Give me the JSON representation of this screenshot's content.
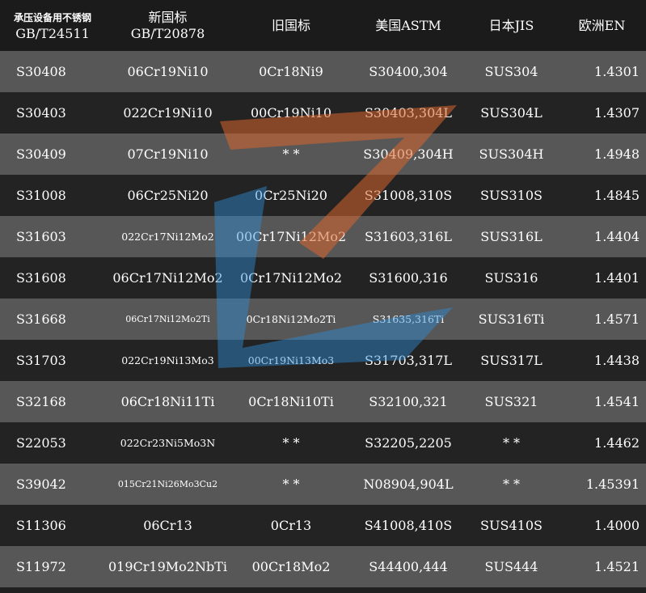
{
  "headers": {
    "col1_line1": "承压设备用不锈钢",
    "col1_line2": "GB/T24511",
    "col2_line1": "新国标",
    "col2_line2": "GB/T20878",
    "col3": "旧国标",
    "col4": "美国ASTM",
    "col5": "日本JIS",
    "col6": "欧洲EN"
  },
  "rows": [
    {
      "gb24511": "S30408",
      "gb20878": "06Cr19Ni10",
      "old_gb": "0Cr18Ni9",
      "astm": "S30400,304",
      "jis": "SUS304",
      "en": "1.4301"
    },
    {
      "gb24511": "S30403",
      "gb20878": "022Cr19Ni10",
      "old_gb": "00Cr19Ni10",
      "astm": "S30403,304L",
      "jis": "SUS304L",
      "en": "1.4307"
    },
    {
      "gb24511": "S30409",
      "gb20878": "07Cr19Ni10",
      "old_gb": "* *",
      "astm": "S30409,304H",
      "jis": "SUS304H",
      "en": "1.4948"
    },
    {
      "gb24511": "S31008",
      "gb20878": "06Cr25Ni20",
      "old_gb": "0Cr25Ni20",
      "astm": "S31008,310S",
      "jis": "SUS310S",
      "en": "1.4845"
    },
    {
      "gb24511": "S31603",
      "gb20878": "022Cr17Ni12Mo2",
      "old_gb": "00Cr17Ni12Mo2",
      "astm": "S31603,316L",
      "jis": "SUS316L",
      "en": "1.4404"
    },
    {
      "gb24511": "S31608",
      "gb20878": "06Cr17Ni12Mo2",
      "old_gb": "0Cr17Ni12Mo2",
      "astm": "S31600,316",
      "jis": "SUS316",
      "en": "1.4401"
    },
    {
      "gb24511": "S31668",
      "gb20878": "06Cr17Ni12Mo2Ti",
      "old_gb": "0Cr18Ni12Mo2Ti",
      "astm": "S31635,316Ti",
      "jis": "SUS316Ti",
      "en": "1.4571"
    },
    {
      "gb24511": "S31703",
      "gb20878": "022Cr19Ni13Mo3",
      "old_gb": "00Cr19Ni13Mo3",
      "astm": "S31703,317L",
      "jis": "SUS317L",
      "en": "1.4438"
    },
    {
      "gb24511": "S32168",
      "gb20878": "06Cr18Ni11Ti",
      "old_gb": "0Cr18Ni10Ti",
      "astm": "S32100,321",
      "jis": "SUS321",
      "en": "1.4541"
    },
    {
      "gb24511": "S22053",
      "gb20878": "022Cr23Ni5Mo3N",
      "old_gb": "* *",
      "astm": "S32205,2205",
      "jis": "* *",
      "en": "1.4462"
    },
    {
      "gb24511": "S39042",
      "gb20878": "015Cr21Ni26Mo3Cu2",
      "old_gb": "* *",
      "astm": "N08904,904L",
      "jis": "* *",
      "en": "1.45391"
    },
    {
      "gb24511": "S11306",
      "gb20878": "06Cr13",
      "old_gb": "0Cr13",
      "astm": "S41008,410S",
      "jis": "SUS410S",
      "en": "1.4000"
    },
    {
      "gb24511": "S11972",
      "gb20878": "019Cr19Mo2NbTi",
      "old_gb": "00Cr18Mo2",
      "astm": "S44400,444",
      "jis": "SUS444",
      "en": "1.4521"
    }
  ],
  "colors": {
    "header_bg": "#1b1b1b",
    "row_light": "#575757",
    "row_dark": "#232323",
    "text": "#ffffff",
    "watermark_orange": "#d9662e",
    "watermark_blue": "#2f8fd8"
  }
}
